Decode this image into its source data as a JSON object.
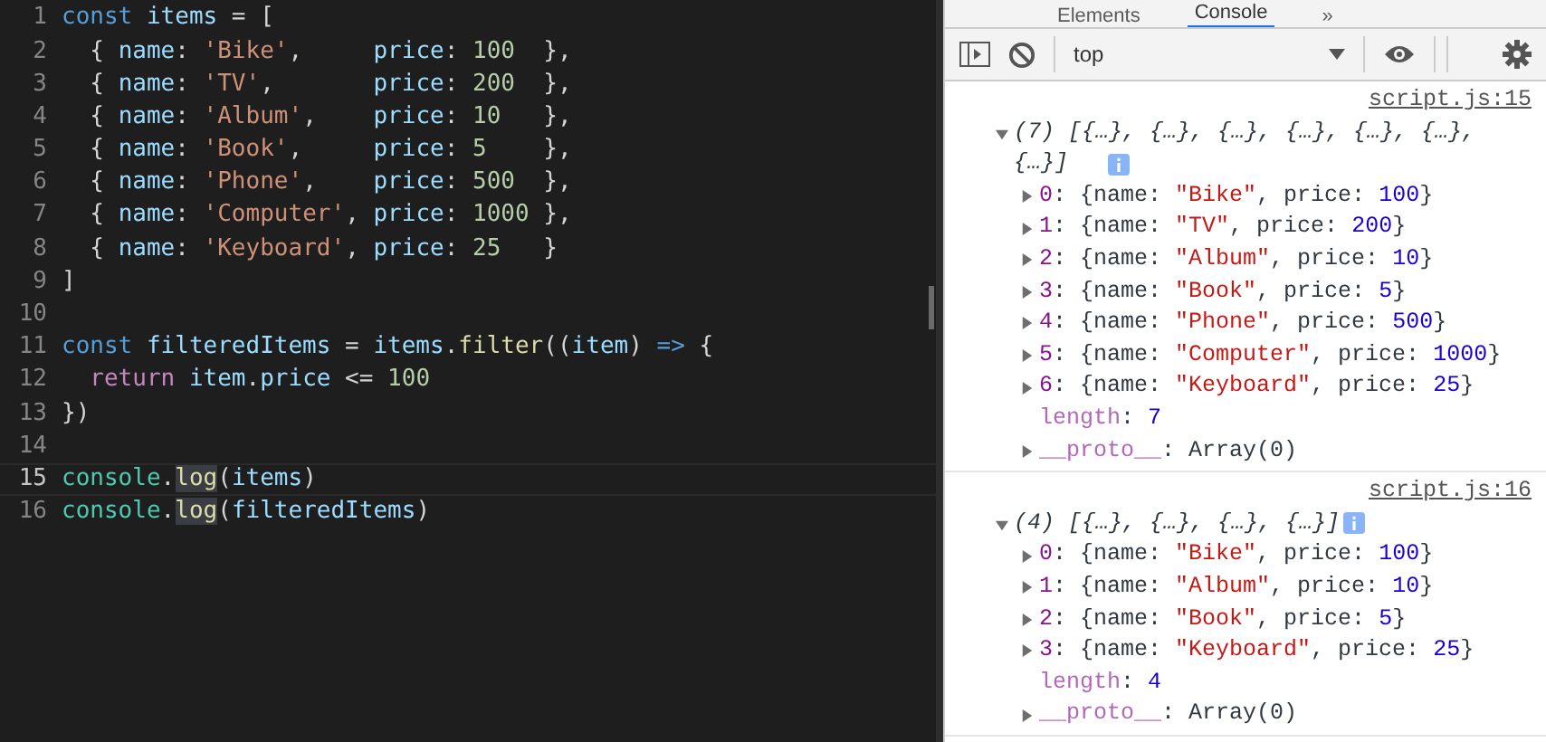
{
  "editor": {
    "lines": [
      {
        "number": "1",
        "current": false,
        "tokens": [
          {
            "kind": "keyword",
            "text": "const"
          },
          {
            "kind": "variable",
            "text": " items"
          },
          {
            "kind": "plain",
            "text": " = ["
          }
        ]
      },
      {
        "number": "2",
        "current": false,
        "tokens": [
          {
            "kind": "plain",
            "text": "  { "
          },
          {
            "kind": "variable",
            "text": "name"
          },
          {
            "kind": "plain",
            "text": ": "
          },
          {
            "kind": "string",
            "text": "'Bike'"
          },
          {
            "kind": "plain",
            "text": ",     "
          },
          {
            "kind": "variable",
            "text": "price"
          },
          {
            "kind": "plain",
            "text": ": "
          },
          {
            "kind": "number",
            "text": "100"
          },
          {
            "kind": "plain",
            "text": "  },"
          }
        ]
      },
      {
        "number": "3",
        "current": false,
        "tokens": [
          {
            "kind": "plain",
            "text": "  { "
          },
          {
            "kind": "variable",
            "text": "name"
          },
          {
            "kind": "plain",
            "text": ": "
          },
          {
            "kind": "string",
            "text": "'TV'"
          },
          {
            "kind": "plain",
            "text": ",       "
          },
          {
            "kind": "variable",
            "text": "price"
          },
          {
            "kind": "plain",
            "text": ": "
          },
          {
            "kind": "number",
            "text": "200"
          },
          {
            "kind": "plain",
            "text": "  },"
          }
        ]
      },
      {
        "number": "4",
        "current": false,
        "tokens": [
          {
            "kind": "plain",
            "text": "  { "
          },
          {
            "kind": "variable",
            "text": "name"
          },
          {
            "kind": "plain",
            "text": ": "
          },
          {
            "kind": "string",
            "text": "'Album'"
          },
          {
            "kind": "plain",
            "text": ",    "
          },
          {
            "kind": "variable",
            "text": "price"
          },
          {
            "kind": "plain",
            "text": ": "
          },
          {
            "kind": "number",
            "text": "10"
          },
          {
            "kind": "plain",
            "text": "   },"
          }
        ]
      },
      {
        "number": "5",
        "current": false,
        "tokens": [
          {
            "kind": "plain",
            "text": "  { "
          },
          {
            "kind": "variable",
            "text": "name"
          },
          {
            "kind": "plain",
            "text": ": "
          },
          {
            "kind": "string",
            "text": "'Book'"
          },
          {
            "kind": "plain",
            "text": ",     "
          },
          {
            "kind": "variable",
            "text": "price"
          },
          {
            "kind": "plain",
            "text": ": "
          },
          {
            "kind": "number",
            "text": "5"
          },
          {
            "kind": "plain",
            "text": "    },"
          }
        ]
      },
      {
        "number": "6",
        "current": false,
        "tokens": [
          {
            "kind": "plain",
            "text": "  { "
          },
          {
            "kind": "variable",
            "text": "name"
          },
          {
            "kind": "plain",
            "text": ": "
          },
          {
            "kind": "string",
            "text": "'Phone'"
          },
          {
            "kind": "plain",
            "text": ",    "
          },
          {
            "kind": "variable",
            "text": "price"
          },
          {
            "kind": "plain",
            "text": ": "
          },
          {
            "kind": "number",
            "text": "500"
          },
          {
            "kind": "plain",
            "text": "  },"
          }
        ]
      },
      {
        "number": "7",
        "current": false,
        "tokens": [
          {
            "kind": "plain",
            "text": "  { "
          },
          {
            "kind": "variable",
            "text": "name"
          },
          {
            "kind": "plain",
            "text": ": "
          },
          {
            "kind": "string",
            "text": "'Computer'"
          },
          {
            "kind": "plain",
            "text": ", "
          },
          {
            "kind": "variable",
            "text": "price"
          },
          {
            "kind": "plain",
            "text": ": "
          },
          {
            "kind": "number",
            "text": "1000"
          },
          {
            "kind": "plain",
            "text": " },"
          }
        ]
      },
      {
        "number": "8",
        "current": false,
        "tokens": [
          {
            "kind": "plain",
            "text": "  { "
          },
          {
            "kind": "variable",
            "text": "name"
          },
          {
            "kind": "plain",
            "text": ": "
          },
          {
            "kind": "string",
            "text": "'Keyboard'"
          },
          {
            "kind": "plain",
            "text": ", "
          },
          {
            "kind": "variable",
            "text": "price"
          },
          {
            "kind": "plain",
            "text": ": "
          },
          {
            "kind": "number",
            "text": "25"
          },
          {
            "kind": "plain",
            "text": "   }"
          }
        ]
      },
      {
        "number": "9",
        "current": false,
        "tokens": [
          {
            "kind": "plain",
            "text": "]"
          }
        ]
      },
      {
        "number": "10",
        "current": false
      },
      {
        "number": "11",
        "current": false,
        "tokens": [
          {
            "kind": "keyword",
            "text": "const"
          },
          {
            "kind": "variable",
            "text": " filteredItems"
          },
          {
            "kind": "plain",
            "text": " = "
          },
          {
            "kind": "variable",
            "text": "items"
          },
          {
            "kind": "plain",
            "text": "."
          },
          {
            "kind": "function",
            "text": "filter"
          },
          {
            "kind": "plain",
            "text": "(("
          },
          {
            "kind": "variable",
            "text": "item"
          },
          {
            "kind": "plain",
            "text": ") "
          },
          {
            "kind": "keyword",
            "text": "=>"
          },
          {
            "kind": "plain",
            "text": " {"
          }
        ]
      },
      {
        "number": "12",
        "current": false,
        "tokens": [
          {
            "kind": "control",
            "text": "  return"
          },
          {
            "kind": "variable",
            "text": " item"
          },
          {
            "kind": "plain",
            "text": "."
          },
          {
            "kind": "variable",
            "text": "price"
          },
          {
            "kind": "plain",
            "text": " <= "
          },
          {
            "kind": "number",
            "text": "100"
          }
        ]
      },
      {
        "number": "13",
        "current": false,
        "tokens": [
          {
            "kind": "plain",
            "text": "})"
          }
        ]
      },
      {
        "number": "14",
        "current": false
      },
      {
        "number": "15",
        "current": true,
        "tokens": [
          {
            "kind": "class",
            "text": "console"
          },
          {
            "kind": "plain",
            "text": "."
          },
          {
            "kind": "match",
            "text": "log"
          },
          {
            "kind": "plain",
            "text": "("
          },
          {
            "kind": "variable",
            "text": "items"
          },
          {
            "kind": "plain",
            "text": ")"
          }
        ]
      },
      {
        "number": "16",
        "current": false,
        "tokens": [
          {
            "kind": "class",
            "text": "console"
          },
          {
            "kind": "plain",
            "text": "."
          },
          {
            "kind": "match",
            "text": "log"
          },
          {
            "kind": "plain",
            "text": "("
          },
          {
            "kind": "variable",
            "text": "filteredItems"
          },
          {
            "kind": "plain",
            "text": ")"
          }
        ]
      }
    ]
  },
  "devtools": {
    "tabs": [
      {
        "label": "Elements",
        "selected": false
      },
      {
        "label": "Console",
        "selected": true
      },
      {
        "label": "»",
        "selected": false
      }
    ],
    "context": "top",
    "groups": [
      {
        "source": "script.js:15",
        "summary": "(7) [{…}, {…}, {…}, {…}, {…}, {…}, {…}]",
        "expanded": true,
        "lines": [
          {
            "expandable": true,
            "tokens": [
              {
                "kind": "key",
                "text": "0"
              },
              {
                "kind": "plain",
                "text": ": {name: "
              },
              {
                "kind": "string",
                "text": "\"Bike\""
              },
              {
                "kind": "plain",
                "text": ", price: "
              },
              {
                "kind": "number",
                "text": "100"
              },
              {
                "kind": "plain",
                "text": "}"
              }
            ]
          },
          {
            "expandable": true,
            "tokens": [
              {
                "kind": "key",
                "text": "1"
              },
              {
                "kind": "plain",
                "text": ": {name: "
              },
              {
                "kind": "string",
                "text": "\"TV\""
              },
              {
                "kind": "plain",
                "text": ", price: "
              },
              {
                "kind": "number",
                "text": "200"
              },
              {
                "kind": "plain",
                "text": "}"
              }
            ]
          },
          {
            "expandable": true,
            "tokens": [
              {
                "kind": "key",
                "text": "2"
              },
              {
                "kind": "plain",
                "text": ": {name: "
              },
              {
                "kind": "string",
                "text": "\"Album\""
              },
              {
                "kind": "plain",
                "text": ", price: "
              },
              {
                "kind": "number",
                "text": "10"
              },
              {
                "kind": "plain",
                "text": "}"
              }
            ]
          },
          {
            "expandable": true,
            "tokens": [
              {
                "kind": "key",
                "text": "3"
              },
              {
                "kind": "plain",
                "text": ": {name: "
              },
              {
                "kind": "string",
                "text": "\"Book\""
              },
              {
                "kind": "plain",
                "text": ", price: "
              },
              {
                "kind": "number",
                "text": "5"
              },
              {
                "kind": "plain",
                "text": "}"
              }
            ]
          },
          {
            "expandable": true,
            "tokens": [
              {
                "kind": "key",
                "text": "4"
              },
              {
                "kind": "plain",
                "text": ": {name: "
              },
              {
                "kind": "string",
                "text": "\"Phone\""
              },
              {
                "kind": "plain",
                "text": ", price: "
              },
              {
                "kind": "number",
                "text": "500"
              },
              {
                "kind": "plain",
                "text": "}"
              }
            ]
          },
          {
            "expandable": true,
            "tokens": [
              {
                "kind": "key",
                "text": "5"
              },
              {
                "kind": "plain",
                "text": ": {name: "
              },
              {
                "kind": "string",
                "text": "\"Computer\""
              },
              {
                "kind": "plain",
                "text": ", price: "
              },
              {
                "kind": "number",
                "text": "1000"
              },
              {
                "kind": "plain",
                "text": "}"
              }
            ]
          },
          {
            "expandable": true,
            "tokens": [
              {
                "kind": "key",
                "text": "6"
              },
              {
                "kind": "plain",
                "text": ": {name: "
              },
              {
                "kind": "string",
                "text": "\"Keyboard\""
              },
              {
                "kind": "plain",
                "text": ", price: "
              },
              {
                "kind": "number",
                "text": "25"
              },
              {
                "kind": "plain",
                "text": "}"
              }
            ]
          },
          {
            "expandable": false,
            "tokens": [
              {
                "kind": "meta",
                "text": "length"
              },
              {
                "kind": "plain",
                "text": ": "
              },
              {
                "kind": "number",
                "text": "7"
              }
            ]
          },
          {
            "expandable": true,
            "tokens": [
              {
                "kind": "meta",
                "text": "__proto__"
              },
              {
                "kind": "plain",
                "text": ": Array(0)"
              }
            ]
          }
        ]
      },
      {
        "source": "script.js:16",
        "summary": "(4) [{…}, {…}, {…}, {…}]",
        "expanded": true,
        "lines": [
          {
            "expandable": true,
            "tokens": [
              {
                "kind": "key",
                "text": "0"
              },
              {
                "kind": "plain",
                "text": ": {name: "
              },
              {
                "kind": "string",
                "text": "\"Bike\""
              },
              {
                "kind": "plain",
                "text": ", price: "
              },
              {
                "kind": "number",
                "text": "100"
              },
              {
                "kind": "plain",
                "text": "}"
              }
            ]
          },
          {
            "expandable": true,
            "tokens": [
              {
                "kind": "key",
                "text": "1"
              },
              {
                "kind": "plain",
                "text": ": {name: "
              },
              {
                "kind": "string",
                "text": "\"Album\""
              },
              {
                "kind": "plain",
                "text": ", price: "
              },
              {
                "kind": "number",
                "text": "10"
              },
              {
                "kind": "plain",
                "text": "}"
              }
            ]
          },
          {
            "expandable": true,
            "tokens": [
              {
                "kind": "key",
                "text": "2"
              },
              {
                "kind": "plain",
                "text": ": {name: "
              },
              {
                "kind": "string",
                "text": "\"Book\""
              },
              {
                "kind": "plain",
                "text": ", price: "
              },
              {
                "kind": "number",
                "text": "5"
              },
              {
                "kind": "plain",
                "text": "}"
              }
            ]
          },
          {
            "expandable": true,
            "tokens": [
              {
                "kind": "key",
                "text": "3"
              },
              {
                "kind": "plain",
                "text": ": {name: "
              },
              {
                "kind": "string",
                "text": "\"Keyboard\""
              },
              {
                "kind": "plain",
                "text": ", price: "
              },
              {
                "kind": "number",
                "text": "25"
              },
              {
                "kind": "plain",
                "text": "}"
              }
            ]
          },
          {
            "expandable": false,
            "tokens": [
              {
                "kind": "meta",
                "text": "length"
              },
              {
                "kind": "plain",
                "text": ": "
              },
              {
                "kind": "number",
                "text": "4"
              }
            ]
          },
          {
            "expandable": true,
            "tokens": [
              {
                "kind": "meta",
                "text": "__proto__"
              },
              {
                "kind": "plain",
                "text": ": Array(0)"
              }
            ]
          }
        ]
      }
    ]
  }
}
